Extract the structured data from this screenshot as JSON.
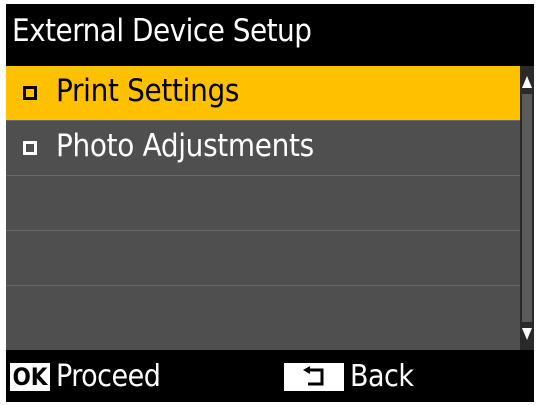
{
  "header": {
    "title": "External Device Setup"
  },
  "menu": {
    "items": [
      {
        "label": "Print Settings",
        "selected": true
      },
      {
        "label": "Photo Adjustments",
        "selected": false
      },
      {
        "label": "",
        "selected": false
      },
      {
        "label": "",
        "selected": false
      },
      {
        "label": "",
        "selected": false
      }
    ]
  },
  "footer": {
    "ok_key": "OK",
    "ok_action": "Proceed",
    "back_action": "Back"
  },
  "colors": {
    "selection": "#ffc000",
    "panel": "#4f4f4f",
    "background": "#000000",
    "text": "#ffffff"
  }
}
